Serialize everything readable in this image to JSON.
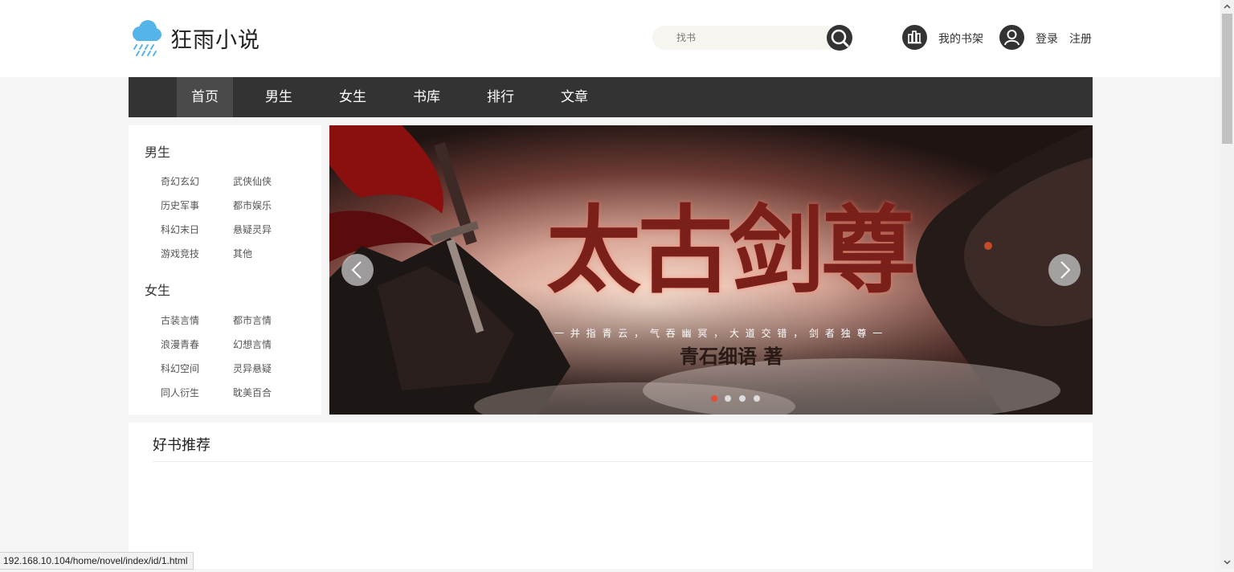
{
  "header": {
    "logo_text": "狂雨小说",
    "search": {
      "placeholder": "找书",
      "value": ""
    },
    "bookshelf_label": "我的书架",
    "login_label": "登录",
    "register_label": "注册"
  },
  "nav": {
    "items": [
      {
        "label": "首页",
        "active": true
      },
      {
        "label": "男生"
      },
      {
        "label": "女生"
      },
      {
        "label": "书库"
      },
      {
        "label": "排行"
      },
      {
        "label": "文章"
      }
    ]
  },
  "categories": {
    "male": {
      "heading": "男生",
      "items": [
        "奇幻玄幻",
        "武侠仙侠",
        "历史军事",
        "都市娱乐",
        "科幻末日",
        "悬疑灵异",
        "游戏竞技",
        "其他"
      ]
    },
    "female": {
      "heading": "女生",
      "items": [
        "古装言情",
        "都市言情",
        "浪漫青春",
        "幻想言情",
        "科幻空间",
        "灵异悬疑",
        "同人衍生",
        "耽美百合"
      ]
    }
  },
  "banner": {
    "title": "太古剑尊",
    "tagline": "一 并 指 青 云 ， 气 吞 幽 冥 ， 大 道 交 错 ， 剑 者 独 尊 一",
    "author": "青石细语 著",
    "slide_count": 4,
    "active_slide": 1
  },
  "recommend": {
    "title": "好书推荐"
  },
  "status_bar": {
    "url": "192.168.10.104/home/novel/index/id/1.html"
  },
  "colors": {
    "nav_bg": "#333333",
    "nav_active": "#4a4a4a",
    "dot_active": "#e44c3a",
    "logo_blue": "#55b4e8"
  },
  "icons": {
    "logo": "rain-cloud-icon",
    "search": "search-icon",
    "bookshelf": "bookshelf-icon",
    "user": "user-icon",
    "prev": "chevron-left-icon",
    "next": "chevron-right-icon"
  }
}
